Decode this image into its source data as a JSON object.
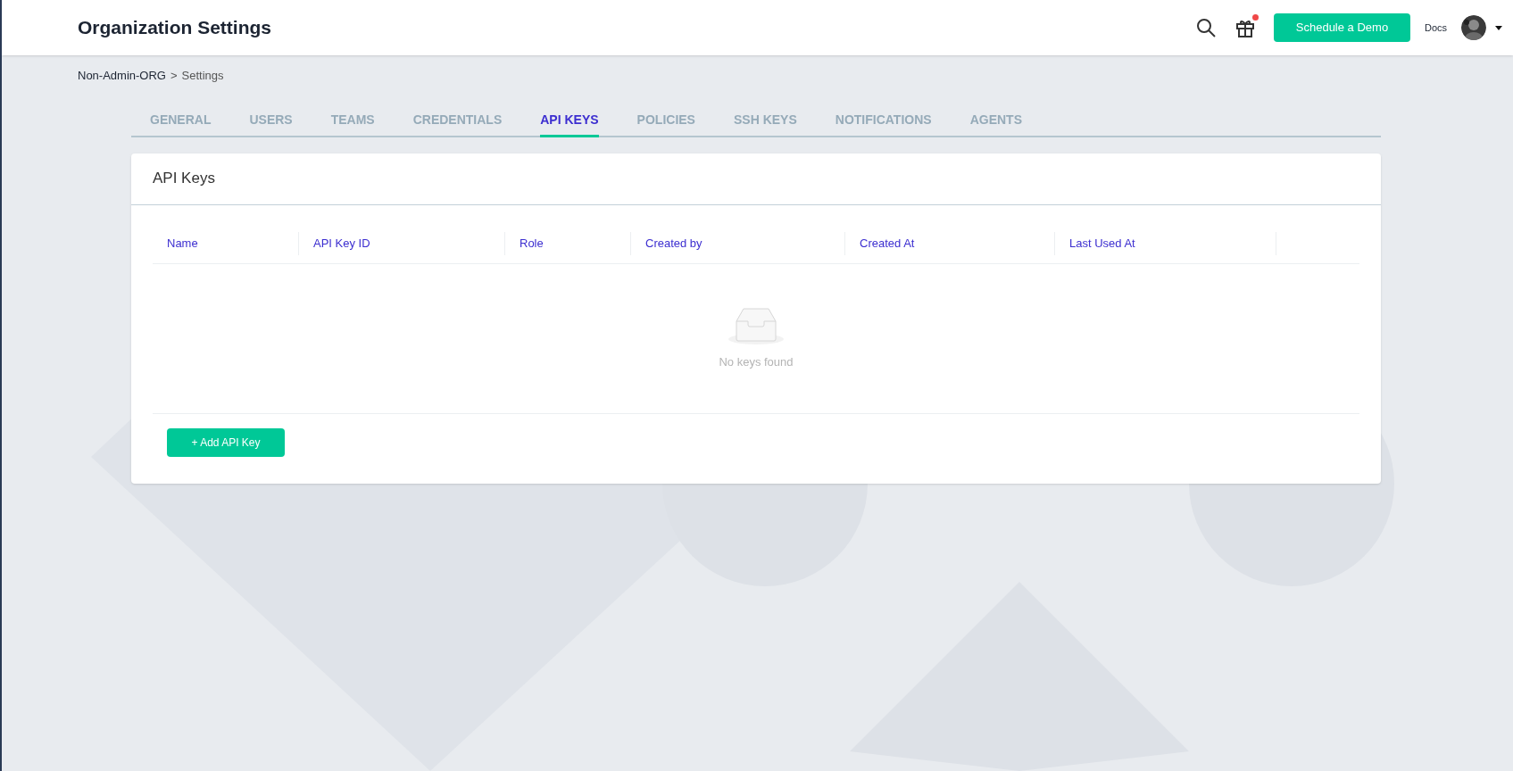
{
  "header": {
    "title": "Organization Settings",
    "gift_has_notification": true,
    "demo_button": "Schedule a Demo",
    "docs_link": "Docs"
  },
  "breadcrumb": {
    "org": "Non-Admin-ORG",
    "separator": ">",
    "page": "Settings"
  },
  "tabs": [
    {
      "label": "GENERAL",
      "selected": false
    },
    {
      "label": "USERS",
      "selected": false
    },
    {
      "label": "TEAMS",
      "selected": false
    },
    {
      "label": "CREDENTIALS",
      "selected": false
    },
    {
      "label": "API KEYS",
      "selected": true
    },
    {
      "label": "POLICIES",
      "selected": false
    },
    {
      "label": "SSH KEYS",
      "selected": false
    },
    {
      "label": "NOTIFICATIONS",
      "selected": false
    },
    {
      "label": "AGENTS",
      "selected": false
    }
  ],
  "card": {
    "title": "API Keys",
    "table": {
      "columns": [
        "Name",
        "API Key ID",
        "Role",
        "Created by",
        "Created At",
        "Last Used At"
      ],
      "empty_text": "No keys found"
    },
    "add_button": "+ Add API Key"
  }
}
